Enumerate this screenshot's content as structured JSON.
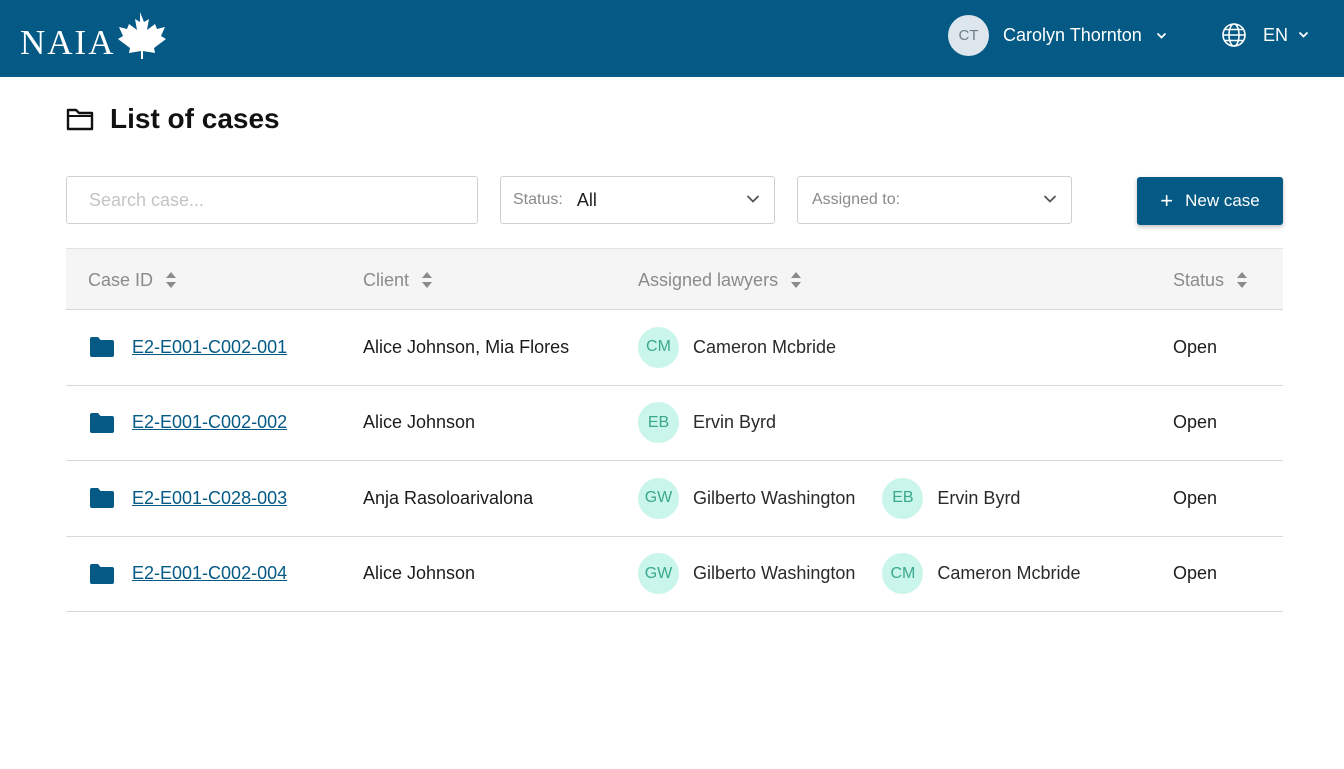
{
  "app": {
    "logo_text": "NAIA"
  },
  "colors": {
    "brand": "#045a85",
    "lawyer_avatar_bg": "#c9f5ea",
    "lawyer_avatar_text": "#3aa88f"
  },
  "user": {
    "initials": "CT",
    "name": "Carolyn Thornton",
    "icon": "chevron-down-icon"
  },
  "language": {
    "code": "EN",
    "icon": "globe-icon"
  },
  "page": {
    "title": "List of cases",
    "icon": "folder-outline-icon"
  },
  "filters": {
    "search_placeholder": "Search case...",
    "search_value": "",
    "status_label": "Status:",
    "status_value": "All",
    "assigned_label": "Assigned to:",
    "assigned_value": ""
  },
  "actions": {
    "new_case_label": "New case",
    "new_case_icon": "plus-icon"
  },
  "table": {
    "columns": [
      "Case ID",
      "Client",
      "Assigned lawyers",
      "Status"
    ],
    "rows": [
      {
        "case_id": "E2-E001-C002-001",
        "client": "Alice Johnson, Mia Flores",
        "lawyers": [
          {
            "initials": "CM",
            "name": "Cameron Mcbride"
          }
        ],
        "status": "Open"
      },
      {
        "case_id": "E2-E001-C002-002",
        "client": "Alice Johnson",
        "lawyers": [
          {
            "initials": "EB",
            "name": "Ervin Byrd"
          }
        ],
        "status": "Open"
      },
      {
        "case_id": "E2-E001-C028-003",
        "client": "Anja Rasoloarivalona",
        "lawyers": [
          {
            "initials": "GW",
            "name": "Gilberto Washington"
          },
          {
            "initials": "EB",
            "name": "Ervin Byrd"
          }
        ],
        "status": "Open"
      },
      {
        "case_id": "E2-E001-C002-004",
        "client": "Alice Johnson",
        "lawyers": [
          {
            "initials": "GW",
            "name": "Gilberto Washington"
          },
          {
            "initials": "CM",
            "name": "Cameron Mcbride"
          }
        ],
        "status": "Open"
      }
    ]
  }
}
